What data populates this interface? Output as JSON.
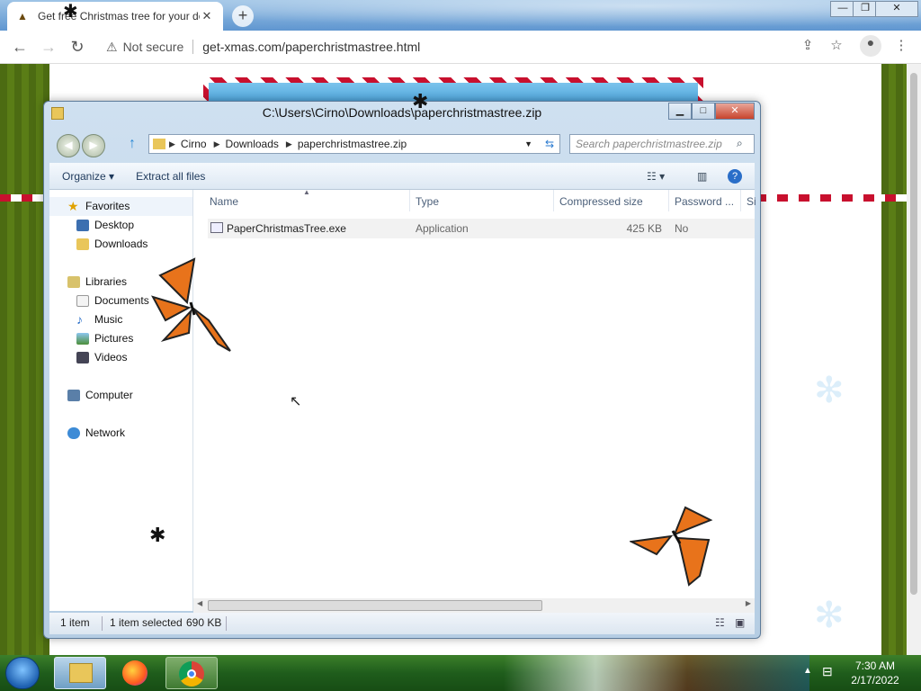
{
  "browser": {
    "tab_title": "Get free Christmas tree for your desktop",
    "tab_close": "✕",
    "new_tab": "+",
    "security": "Not secure",
    "url": "get-xmas.com/paperchristmastree.html",
    "window_buttons": [
      "—",
      "❐",
      "✕"
    ]
  },
  "explorer": {
    "title": "C:\\Users\\Cirno\\Downloads\\paperchristmastree.zip",
    "breadcrumb": [
      "Cirno",
      "Downloads",
      "paperchristmastree.zip"
    ],
    "search_placeholder": "Search paperchristmastree.zip",
    "commands": [
      "Organize ▾",
      "Extract all files"
    ],
    "nav": {
      "favorites": "Favorites",
      "desktop": "Desktop",
      "downloads": "Downloads",
      "libraries": "Libraries",
      "documents": "Documents",
      "music": "Music",
      "pictures": "Pictures",
      "videos": "Videos",
      "computer": "Computer",
      "network": "Network"
    },
    "columns": [
      "Name",
      "Type",
      "Compressed size",
      "Password ...",
      "Si"
    ],
    "file": {
      "name": "PaperChristmasTree.exe",
      "type": "Application",
      "size": "425 KB",
      "password": "No"
    },
    "status": {
      "count": "1 item",
      "selected": "1 item selected",
      "size": "690 KB"
    }
  },
  "taskbar": {
    "time": "7:30 AM",
    "date": "2/17/2022"
  }
}
